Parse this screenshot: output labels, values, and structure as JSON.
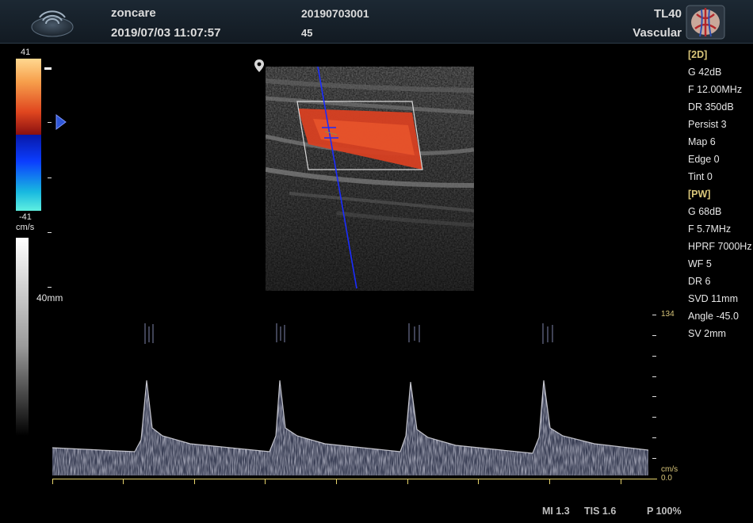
{
  "header": {
    "brand": "zoncare",
    "datetime": "2019/07/03 11:07:57",
    "patient_id": "20190703001",
    "frame_number": "45",
    "probe": "TL40",
    "preset": "Vascular"
  },
  "color_scale": {
    "top_value": "41",
    "bottom_value": "-41",
    "unit": "cm/s"
  },
  "depth": {
    "label": "40mm"
  },
  "params": [
    {
      "text": "[2D]",
      "section": true
    },
    {
      "text": "G 42dB"
    },
    {
      "text": "F 12.00MHz"
    },
    {
      "text": "DR 350dB"
    },
    {
      "text": "Persist 3"
    },
    {
      "text": "Map 6"
    },
    {
      "text": "Edge 0"
    },
    {
      "text": "Tint 0"
    },
    {
      "text": "[PW]",
      "section": true
    },
    {
      "text": "G 68dB"
    },
    {
      "text": "F 5.7MHz"
    },
    {
      "text": "HPRF 7000Hz"
    },
    {
      "text": "WF 5"
    },
    {
      "text": "DR 6"
    },
    {
      "text": "SVD 11mm"
    },
    {
      "text": "Angle -45.0"
    },
    {
      "text": "SV 2mm"
    }
  ],
  "doppler_scale": {
    "max": "134",
    "unit": "cm/s",
    "zero": "0.0"
  },
  "footer": {
    "mi": "MI 1.3",
    "tis": "TIS 1.6",
    "power": "P 100%"
  },
  "colors": {
    "accent_yellow": "#d9c67a",
    "baseline": "#e6d36a",
    "flow_red": "#e84a2a",
    "cursor_blue": "#2233ff",
    "header_bg": "#17212b"
  }
}
